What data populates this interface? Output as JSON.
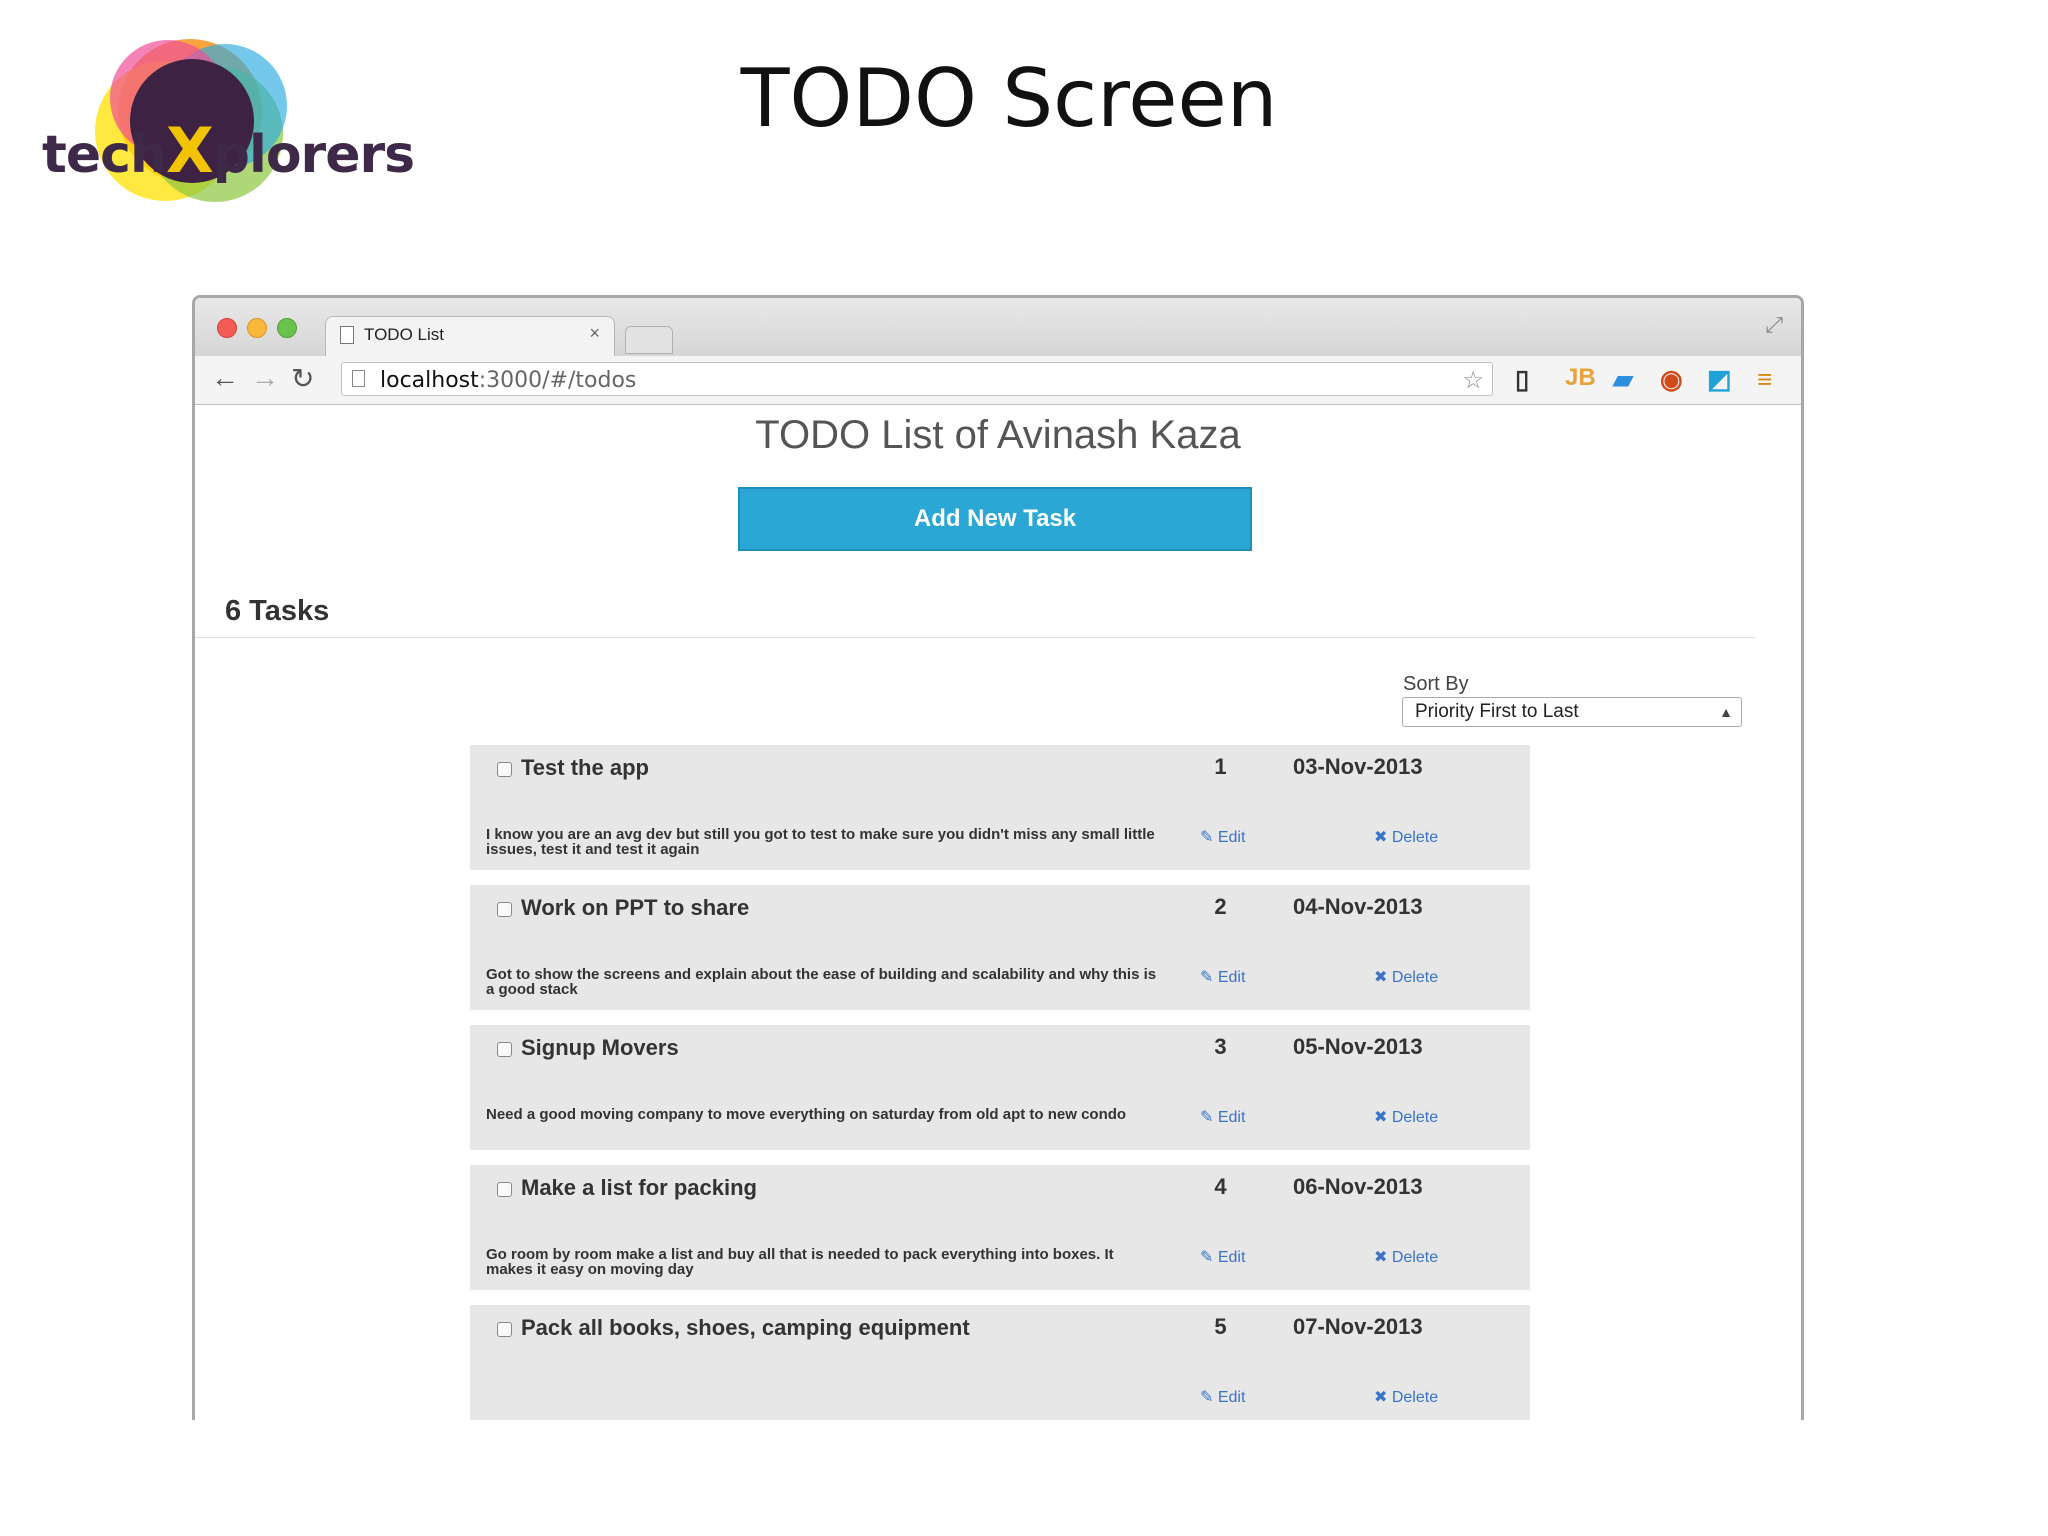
{
  "slide": {
    "title": "TODO Screen",
    "logo": {
      "prefix": "tech",
      "x": "X",
      "suffix": "plorers"
    }
  },
  "browser": {
    "tab_title": "TODO List",
    "tab_close": "×",
    "url_host": "localhost",
    "url_rest": ":3000/#/todos"
  },
  "page": {
    "heading": "TODO List of Avinash Kaza",
    "add_button": "Add New Task",
    "task_count": "6 Tasks",
    "sort_label": "Sort By",
    "sort_value": "Priority First to Last"
  },
  "tasks": [
    {
      "title": "Test the app",
      "priority": "1",
      "date": "03-Nov-2013",
      "description": "I know you are an avg dev but still you got to test to make sure you didn't miss any small little issues, test it and test it again",
      "edit": "✎ Edit",
      "delete": "✖ Delete"
    },
    {
      "title": "Work on PPT to share",
      "priority": "2",
      "date": "04-Nov-2013",
      "description": "Got to show the screens and explain about the ease of building and scalability and why this is a good stack",
      "edit": "✎ Edit",
      "delete": "✖ Delete"
    },
    {
      "title": "Signup Movers",
      "priority": "3",
      "date": "05-Nov-2013",
      "description": "Need a good moving company to move everything on saturday from old apt to new condo",
      "edit": "✎ Edit",
      "delete": "✖ Delete"
    },
    {
      "title": "Make a list for packing",
      "priority": "4",
      "date": "06-Nov-2013",
      "description": "Go room by room make a list and buy all that is needed to pack everything into boxes. It makes it easy on moving day",
      "edit": "✎ Edit",
      "delete": "✖ Delete"
    },
    {
      "title": "Pack all books, shoes, camping equipment",
      "priority": "5",
      "date": "07-Nov-2013",
      "description": "",
      "edit": "✎ Edit",
      "delete": "✖ Delete"
    }
  ],
  "icons": {
    "logo_colors": [
      "#f04e98",
      "#f7941d",
      "#ffe000",
      "#8cc63f",
      "#29abe2",
      "#3d2243"
    ]
  }
}
